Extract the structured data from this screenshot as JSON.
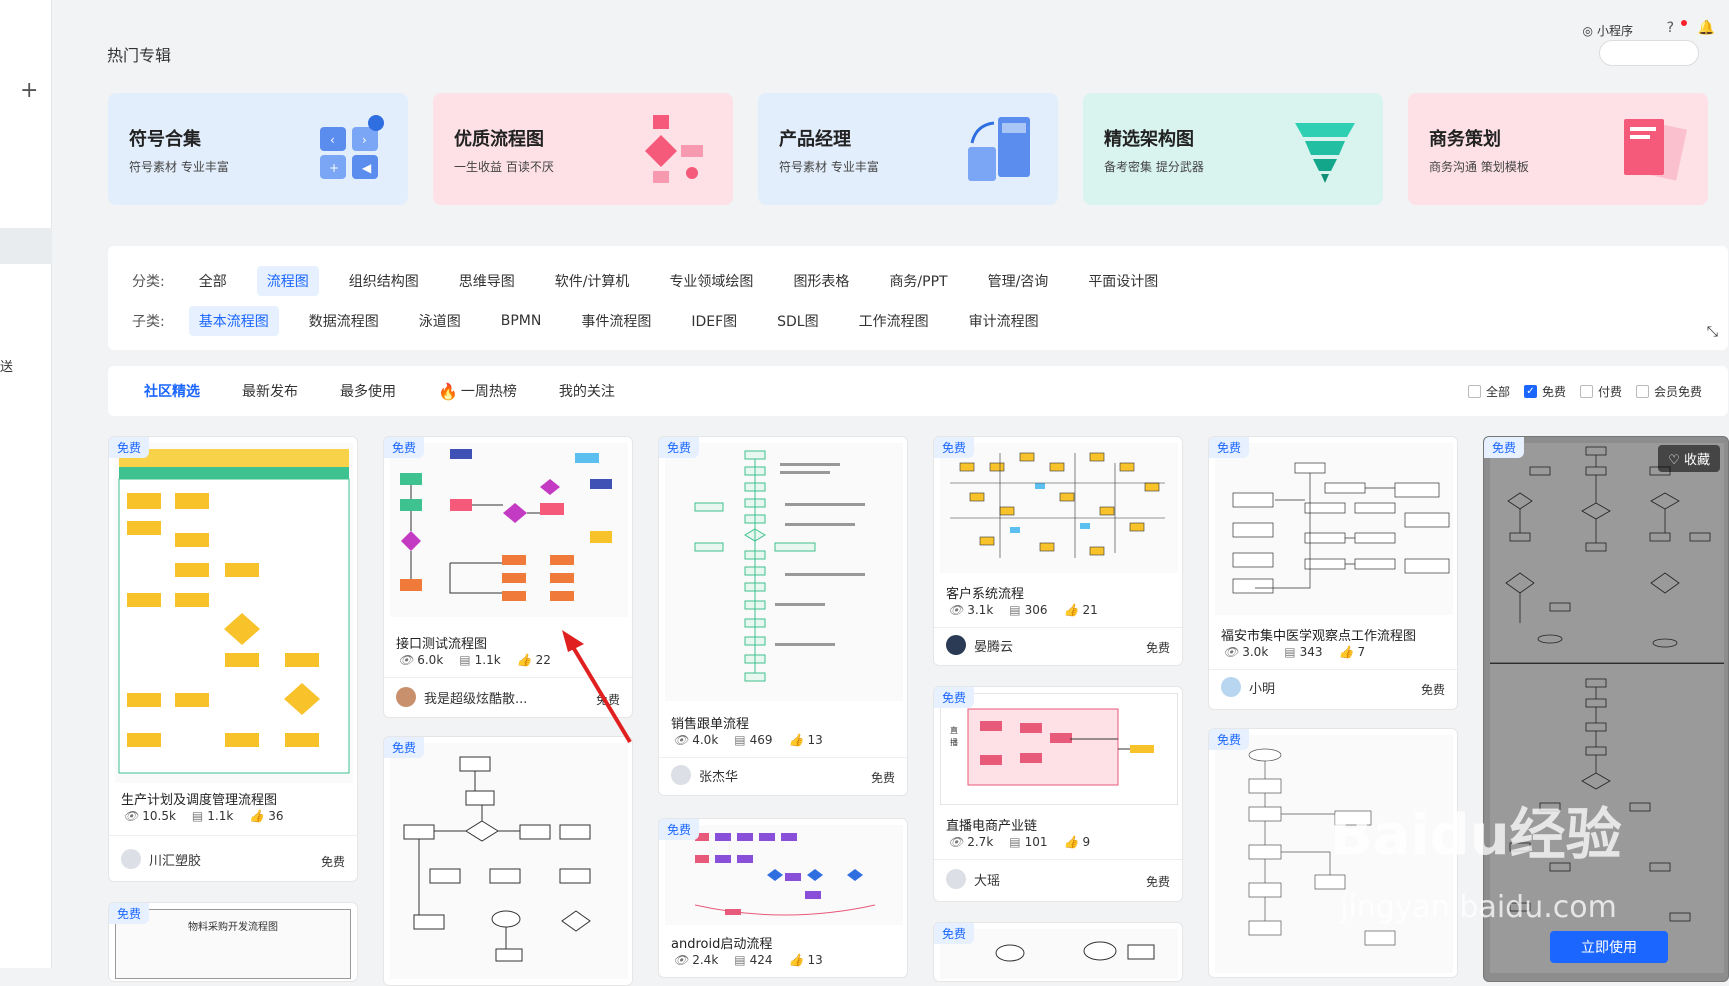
{
  "topbar": {
    "page_title": "热门专辑",
    "mini_program": "小程序",
    "help": "?"
  },
  "left": {
    "send": "送"
  },
  "cards": [
    {
      "title": "符号合集",
      "subtitle": "符号素材 专业丰富",
      "color": "#e3eefc"
    },
    {
      "title": "优质流程图",
      "subtitle": "一生收益 百读不厌",
      "color": "#fde1e7"
    },
    {
      "title": "产品经理",
      "subtitle": "符号素材 专业丰富",
      "color": "#e3eefc"
    },
    {
      "title": "精选架构图",
      "subtitle": "备考密集 提分武器",
      "color": "#d9f4ef"
    },
    {
      "title": "商务策划",
      "subtitle": "商务沟通 策划模板",
      "color": "#fde1e7"
    }
  ],
  "filter": {
    "category_label": "分类:",
    "categories": [
      "全部",
      "流程图",
      "组织结构图",
      "思维导图",
      "软件/计算机",
      "专业领域绘图",
      "图形表格",
      "商务/PPT",
      "管理/咨询",
      "平面设计图"
    ],
    "sub_label": "子类:",
    "subs": [
      "基本流程图",
      "数据流程图",
      "泳道图",
      "BPMN",
      "事件流程图",
      "IDEF图",
      "SDL图",
      "工作流程图",
      "审计流程图"
    ]
  },
  "tabs": [
    "社区精选",
    "最新发布",
    "最多使用",
    "一周热榜",
    "我的关注"
  ],
  "options": [
    "全部",
    "免费",
    "付费",
    "会员免费"
  ],
  "free": "免费",
  "tiles": {
    "t1": {
      "name": "生产计划及调度管理流程图",
      "views": "10.5k",
      "copies": "1.1k",
      "likes": "36",
      "author": "川汇塑胶",
      "price": "免费"
    },
    "t2": {
      "name": "接口测试流程图",
      "views": "6.0k",
      "copies": "1.1k",
      "likes": "22",
      "author": "我是超级炫酷散...",
      "price": "免费"
    },
    "t3": {
      "name": "销售跟单流程",
      "views": "4.0k",
      "copies": "469",
      "likes": "13",
      "author": "张杰华",
      "price": "免费"
    },
    "t4": {
      "name": "客户系统流程",
      "views": "3.1k",
      "copies": "306",
      "likes": "21",
      "author": "晏腾云",
      "price": "免费"
    },
    "t5": {
      "name": "福安市集中医学观察点工作流程图",
      "views": "3.0k",
      "copies": "343",
      "likes": "7",
      "author": "小明",
      "price": "免费"
    },
    "t6": {
      "name": "直播电商产业链",
      "views": "2.7k",
      "copies": "101",
      "likes": "9",
      "author": "大瑶",
      "price": "免费"
    },
    "t7": {
      "name": "android启动流程",
      "views": "2.4k",
      "copies": "424",
      "likes": "13"
    },
    "t8": {
      "thumb_title": "物料采购开发流程图"
    }
  },
  "fav": "收藏",
  "use_now": "立即使用",
  "watermark": {
    "main": "Baidu经验",
    "sub": "jingyan.baidu.com"
  }
}
